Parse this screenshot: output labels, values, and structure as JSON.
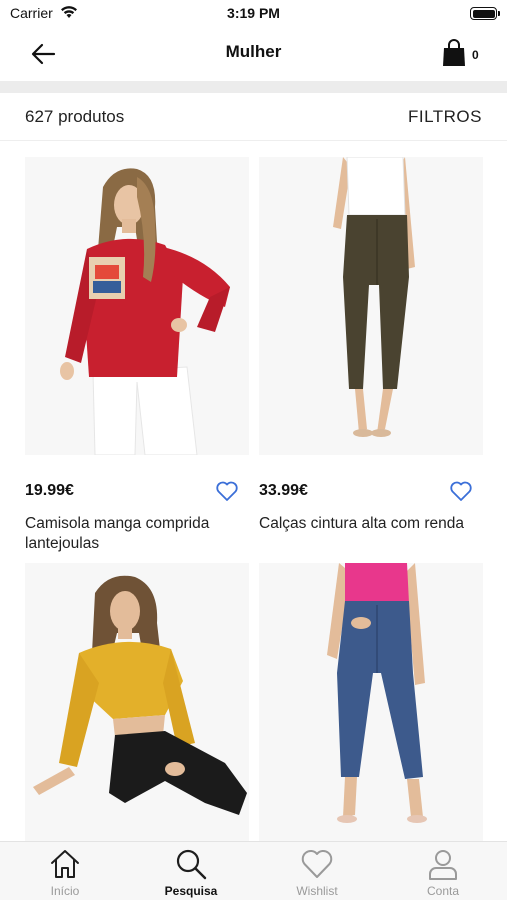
{
  "status_bar": {
    "carrier": "Carrier",
    "time": "3:19 PM"
  },
  "header": {
    "title": "Mulher",
    "cart_count": "0"
  },
  "listing": {
    "count_label": "627 produtos",
    "filters_label": "FILTROS"
  },
  "colors": {
    "accent": "#3b6fd8",
    "sweater": "#c8202f",
    "mustard": "#e3b02a",
    "pink_top": "#e8378c",
    "olive": "#4a4330",
    "denim": "#3d5a8c"
  },
  "products": [
    {
      "price": "19.99€",
      "name": "Camisola manga comprida lantejoulas"
    },
    {
      "price": "33.99€",
      "name": "Calças cintura alta com renda"
    },
    {
      "price": "",
      "name": ""
    },
    {
      "price": "",
      "name": ""
    }
  ],
  "tabs": [
    {
      "label": "Início",
      "icon": "home-icon"
    },
    {
      "label": "Pesquisa",
      "icon": "search-icon",
      "active": true
    },
    {
      "label": "Wishlist",
      "icon": "heart-icon"
    },
    {
      "label": "Conta",
      "icon": "user-icon"
    }
  ]
}
